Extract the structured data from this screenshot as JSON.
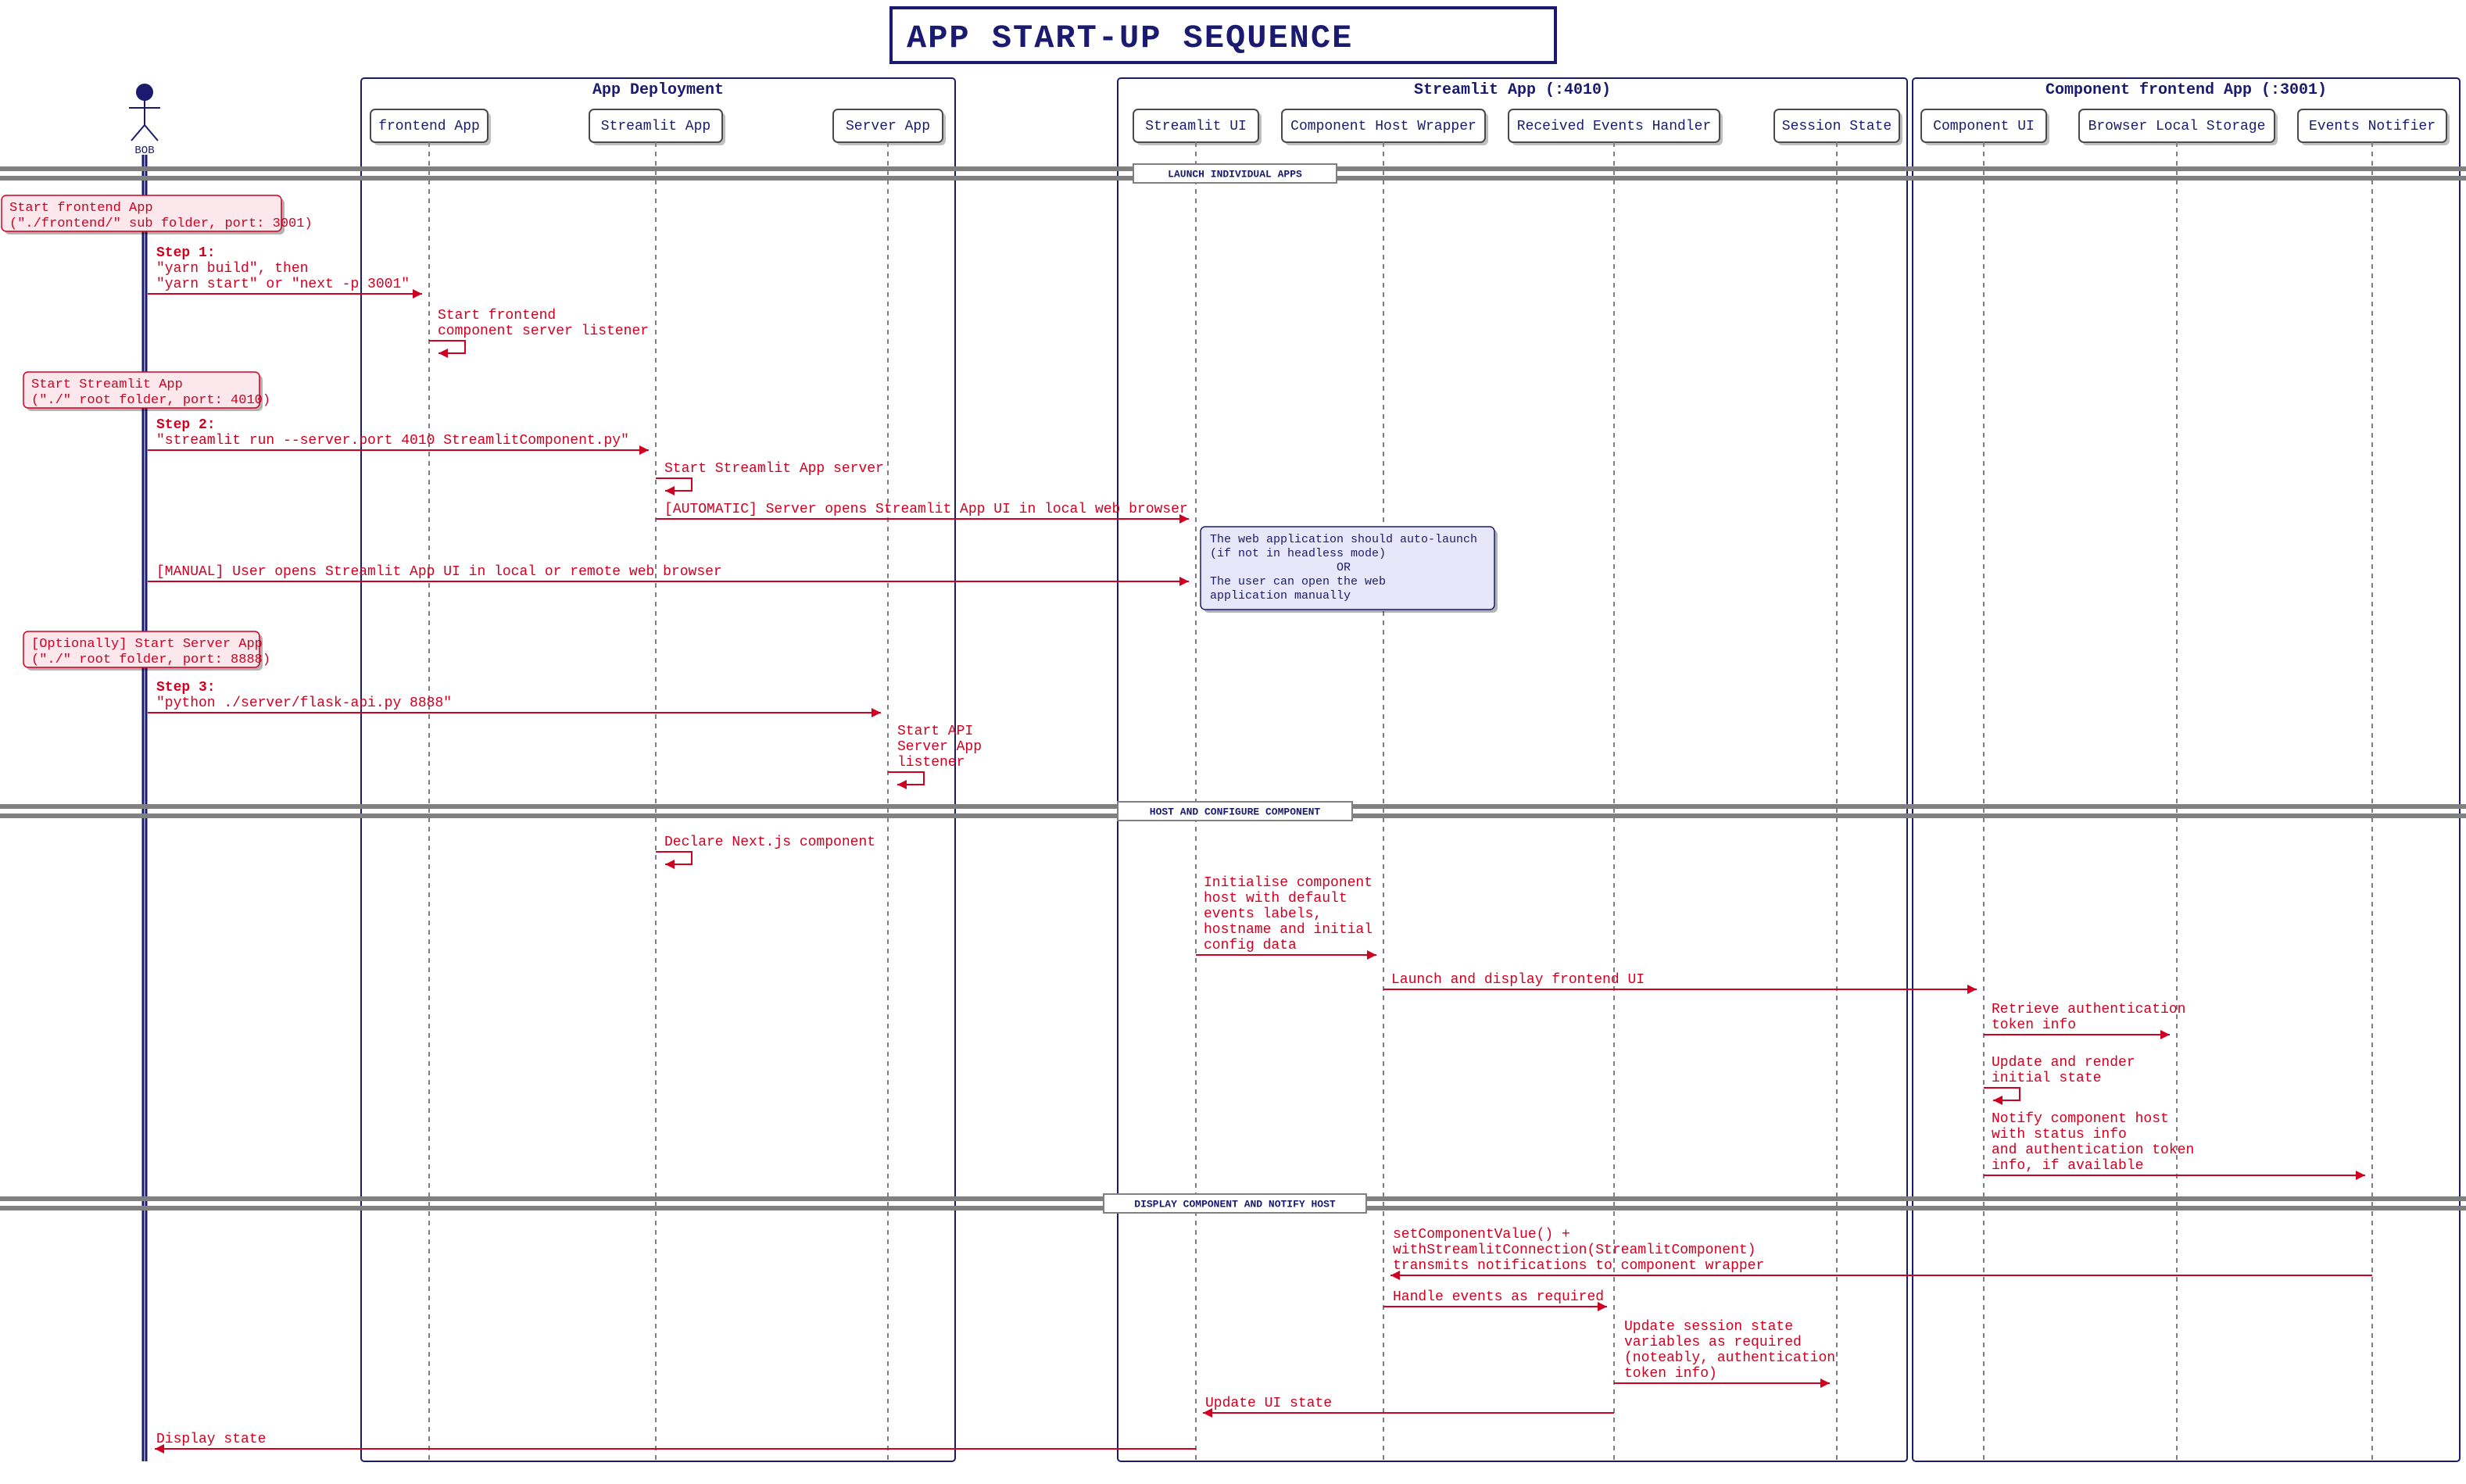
{
  "title": "APP START-UP SEQUENCE",
  "actor": {
    "label": "BOB"
  },
  "groups": {
    "deploy": {
      "title": "App Deployment"
    },
    "stream": {
      "title": "Streamlit App (:4010)"
    },
    "compfe": {
      "title": "Component frontend App (:3001)"
    }
  },
  "participants": {
    "frontend": "frontend App",
    "stapp": "Streamlit App",
    "server": "Server App",
    "stui": "Streamlit UI",
    "chw": "Component Host Wrapper",
    "reh": "Received Events Handler",
    "sstate": "Session State",
    "compui": "Component UI",
    "bls": "Browser Local Storage",
    "notifier": "Events Notifier"
  },
  "dividers": {
    "d1": "LAUNCH INDIVIDUAL APPS",
    "d2": "HOST AND CONFIGURE COMPONENT",
    "d3": "DISPLAY COMPONENT AND NOTIFY HOST"
  },
  "hnotes": {
    "h1a": "Start frontend App",
    "h1b": "(\"./frontend/\" sub folder, port: 3001)",
    "h2a": "Start Streamlit App",
    "h2b": "(\"./\" root folder, port: 4010)",
    "h3a": "[Optionally] Start Server App",
    "h3b": "(\"./\" root folder, port: 8888)"
  },
  "note1": {
    "l1": "The web application should auto-launch",
    "l2": "(if not in headless mode)",
    "l3": "OR",
    "l4": "The user can open the web",
    "l5": "application manually"
  },
  "msgs": {
    "m1a": "Step 1:",
    "m1b": "\"yarn build\", then",
    "m1c": "\"yarn start\" or \"next -p 3001\"",
    "m2a": "Start frontend",
    "m2b": "component server listener",
    "m3a": "Step 2:",
    "m3b": "\"streamlit run --server.port 4010 StreamlitComponent.py\"",
    "m4": "Start Streamlit App server",
    "m5": "[AUTOMATIC] Server opens Streamlit App UI in local web browser",
    "m6": "[MANUAL] User opens Streamlit App UI in local or remote web browser",
    "m7a": "Step 3:",
    "m7b": "\"python ./server/flask-api.py 8888\"",
    "m8a": "Start API",
    "m8b": "Server App",
    "m8c": "listener",
    "m9": "Declare Next.js component",
    "m10a": "Initialise component",
    "m10b": "host with default",
    "m10c": "events labels,",
    "m10d": "hostname and initial",
    "m10e": "config data",
    "m11": "Launch and display frontend UI",
    "m12a": "Retrieve authentication",
    "m12b": "token info",
    "m13a": "Update and render",
    "m13b": "initial state",
    "m14a": "Notify component host",
    "m14b": "with status info",
    "m14c": "and authentication token",
    "m14d": "info, if available",
    "m15a": "setComponentValue() +",
    "m15b": "withStreamlitConnection(StreamlitComponent)",
    "m15c": "transmits notifications to component wrapper",
    "m16": "Handle events as required",
    "m17a": "Update session state",
    "m17b": "variables as required",
    "m17c": "(noteably, authentication",
    "m17d": "token info)",
    "m18": "Update UI state",
    "m19": "Display state"
  }
}
